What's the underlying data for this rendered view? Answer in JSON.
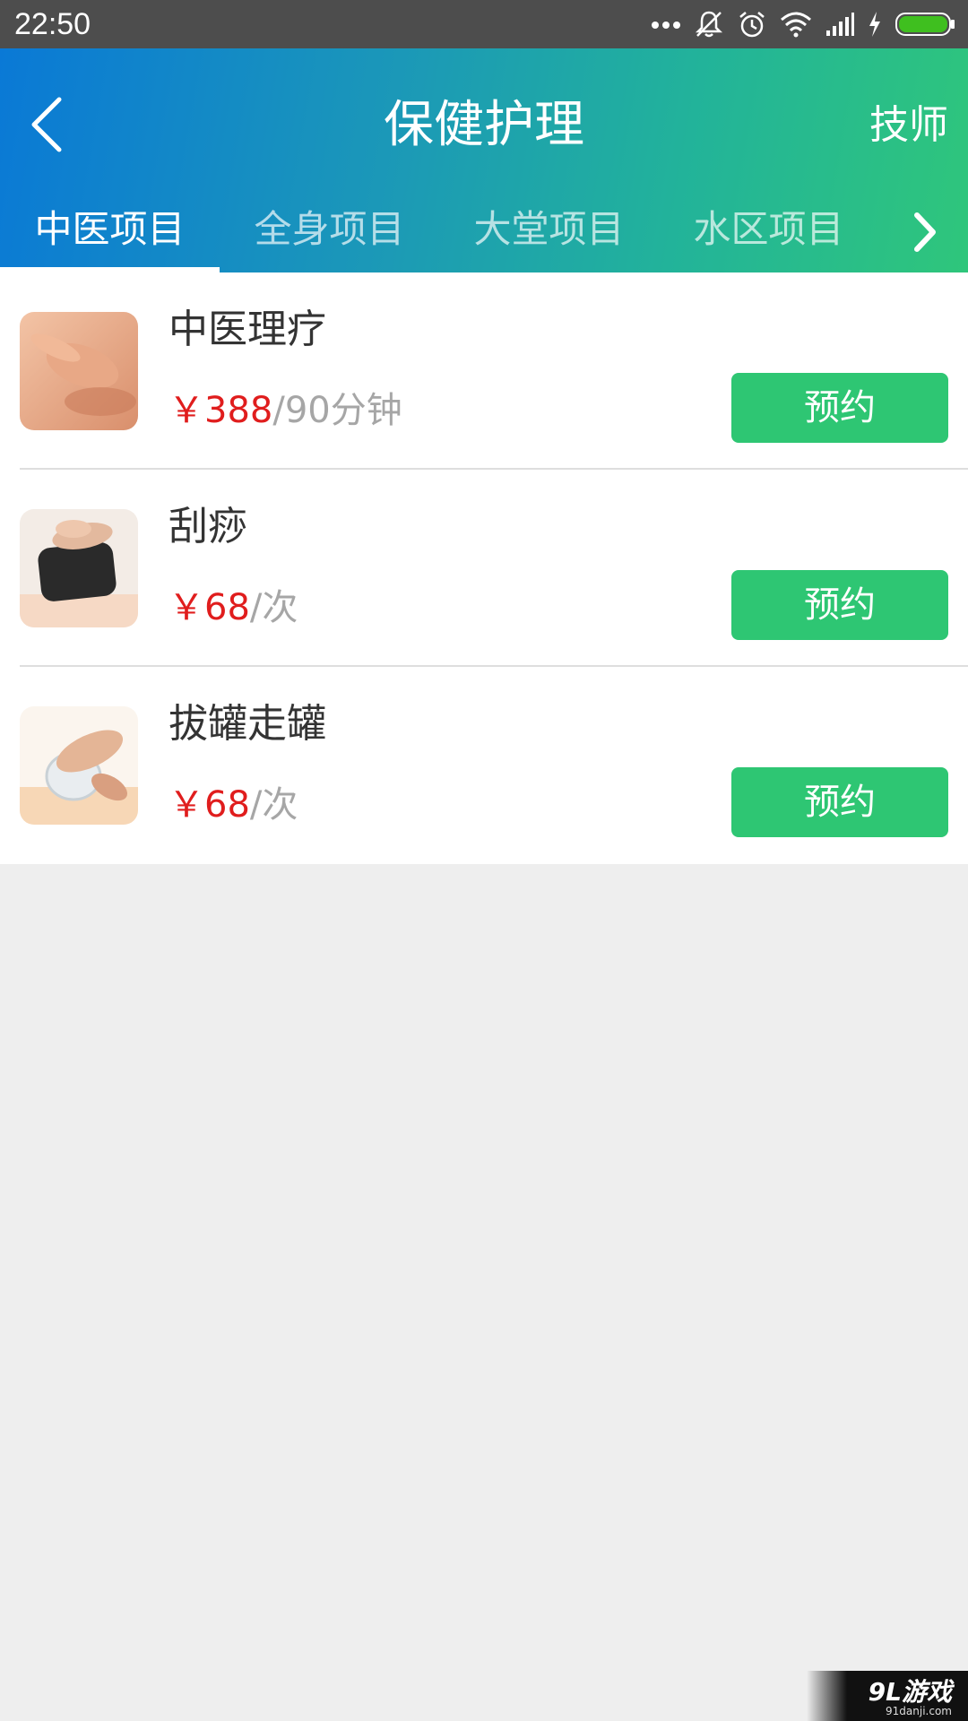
{
  "status_bar": {
    "time": "22:50"
  },
  "header": {
    "title": "保健护理",
    "right_link": "技师"
  },
  "tabs": [
    {
      "label": "中医项目",
      "active": true
    },
    {
      "label": "全身项目",
      "active": false
    },
    {
      "label": "大堂项目",
      "active": false
    },
    {
      "label": "水区项目",
      "active": false
    }
  ],
  "services": [
    {
      "name": "中医理疗",
      "price": "￥388",
      "unit": "/90分钟",
      "button": "预约"
    },
    {
      "name": "刮痧",
      "price": "￥68",
      "unit": "/次",
      "button": "预约"
    },
    {
      "name": "拔罐走罐",
      "price": "￥68",
      "unit": "/次",
      "button": "预约"
    }
  ],
  "watermark": {
    "main": "9L游戏",
    "sub": "91danji.com"
  },
  "colors": {
    "accent_green": "#2ec673",
    "price_red": "#e01d1d",
    "header_gradient_start": "#0a79d6",
    "header_gradient_end": "#2fc67b"
  }
}
